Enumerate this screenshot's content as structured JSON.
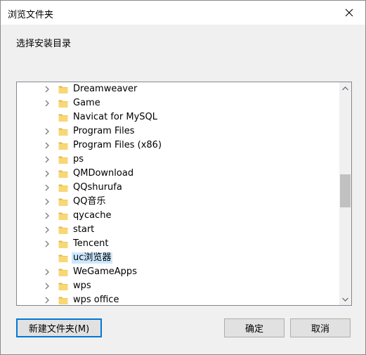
{
  "window": {
    "title": "浏览文件夹",
    "close_icon": "close-icon"
  },
  "prompt": "选择安装目录",
  "tree": {
    "items": [
      {
        "label": "Dreamweaver",
        "has_children": true,
        "selected": false
      },
      {
        "label": "Game",
        "has_children": true,
        "selected": false
      },
      {
        "label": "Navicat for MySQL",
        "has_children": false,
        "selected": false
      },
      {
        "label": "Program Files",
        "has_children": true,
        "selected": false
      },
      {
        "label": "Program Files (x86)",
        "has_children": true,
        "selected": false
      },
      {
        "label": "ps",
        "has_children": true,
        "selected": false
      },
      {
        "label": "QMDownload",
        "has_children": true,
        "selected": false
      },
      {
        "label": "QQshurufa",
        "has_children": true,
        "selected": false
      },
      {
        "label": "QQ音乐",
        "has_children": true,
        "selected": false
      },
      {
        "label": "qycache",
        "has_children": true,
        "selected": false
      },
      {
        "label": "start",
        "has_children": true,
        "selected": false
      },
      {
        "label": "Tencent",
        "has_children": true,
        "selected": false
      },
      {
        "label": "uc浏览器",
        "has_children": false,
        "selected": true
      },
      {
        "label": "WeGameApps",
        "has_children": true,
        "selected": false
      },
      {
        "label": "wps",
        "has_children": true,
        "selected": false
      },
      {
        "label": "wps office",
        "has_children": true,
        "selected": false
      }
    ]
  },
  "buttons": {
    "new_folder": "新建文件夹(M)",
    "ok": "确定",
    "cancel": "取消"
  },
  "colors": {
    "folder": "#f8d775",
    "folder_dark": "#e0b84a",
    "selection": "#cce8ff",
    "focus": "#0078d7"
  }
}
